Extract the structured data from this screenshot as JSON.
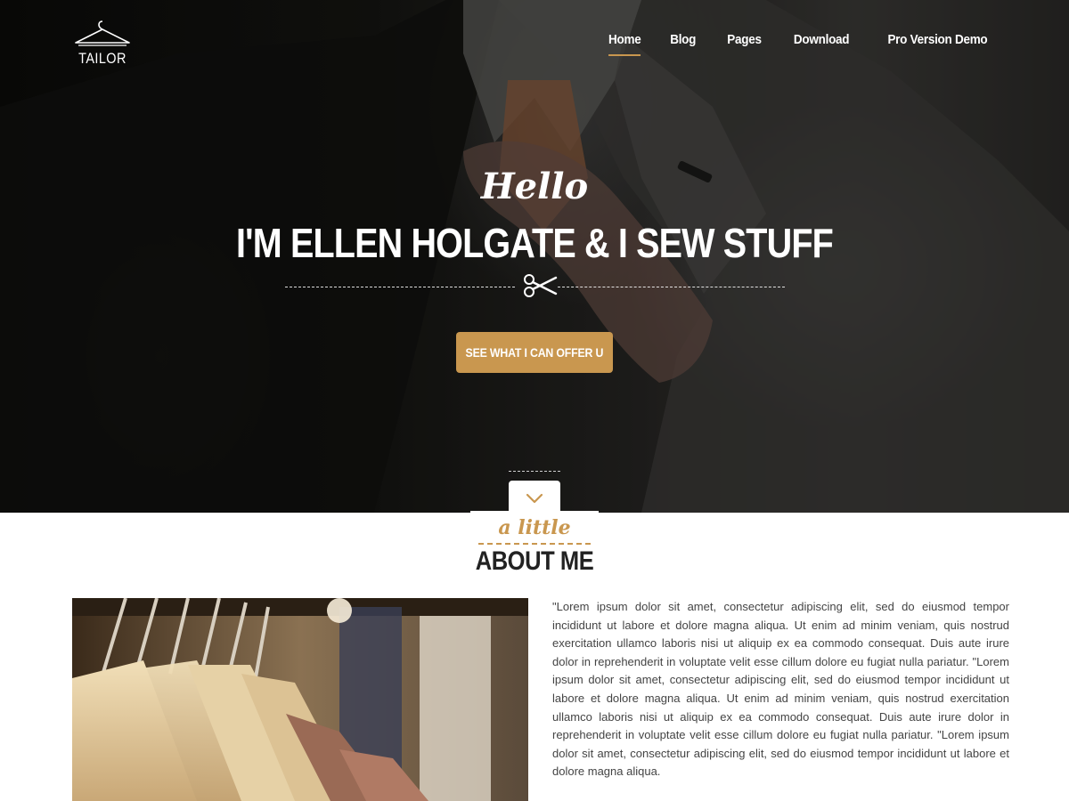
{
  "logo": {
    "text": "TAILOR",
    "icon": "hanger-icon"
  },
  "nav": {
    "items": [
      {
        "label": "Home",
        "active": true
      },
      {
        "label": "Blog",
        "active": false
      },
      {
        "label": "Pages",
        "active": false
      },
      {
        "label": "Download",
        "active": false
      },
      {
        "label": "Pro Version Demo",
        "active": false
      }
    ]
  },
  "hero": {
    "greeting": "Hello",
    "headline": "I'M ELLEN HOLGATE & I SEW STUFF",
    "divider_icon": "scissors-icon",
    "cta_label": "SEE WHAT I CAN OFFER U",
    "scroll_icon": "chevron-down-icon"
  },
  "about": {
    "kicker": "a little",
    "title": "ABOUT ME",
    "body": "\"Lorem ipsum dolor sit amet, consectetur adipiscing elit, sed do eiusmod tempor incididunt ut labore et dolore magna aliqua. Ut enim ad minim veniam, quis nostrud exercitation ullamco laboris nisi ut aliquip ex ea commodo consequat. Duis aute irure dolor in reprehenderit in voluptate velit esse cillum dolore eu fugiat nulla pariatur. \"Lorem ipsum dolor sit amet, consectetur adipiscing elit, sed do eiusmod tempor incididunt ut labore et dolore magna aliqua. Ut enim ad minim veniam, quis nostrud exercitation ullamco laboris nisi ut aliquip ex ea commodo consequat. Duis aute irure dolor in reprehenderit in voluptate velit esse cillum dolore eu fugiat nulla pariatur. \"Lorem ipsum dolor sit amet, consectetur adipiscing elit, sed do eiusmod tempor incididunt ut labore et dolore magna aliqua."
  },
  "colors": {
    "accent": "#c9974f",
    "hero_dark": "#0b0b09",
    "text": "#444444",
    "heading": "#222222"
  }
}
